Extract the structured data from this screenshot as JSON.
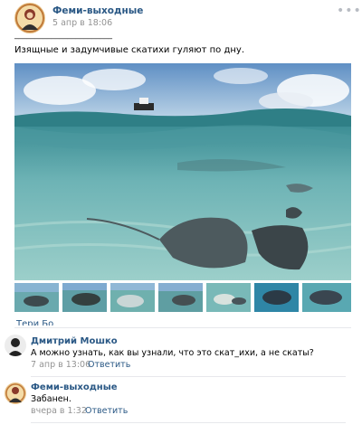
{
  "post": {
    "author": "Феми-выходные",
    "date": "5 апр в 18:06",
    "menu_icon": "more-dots-icon",
    "separator_text": "________________________",
    "text": "Изящные и задумчивые скатихи гуляют по дну."
  },
  "liker_stub": "Тери Бо",
  "comments": [
    {
      "author": "Дмитрий Мошко",
      "text": "А можно узнать, как вы узнали, что это скат_ихи, а не скаты?",
      "date": "7 апр в 13:06",
      "reply": "Ответить"
    },
    {
      "author": "Феми-выходные",
      "text": "Забанен.",
      "date": "вчера в 1:32",
      "reply": "Ответить"
    }
  ],
  "colors": {
    "link": "#2a5885",
    "meta": "#939393",
    "water": "#5aa5a8",
    "sky": "#6f9cc9"
  }
}
